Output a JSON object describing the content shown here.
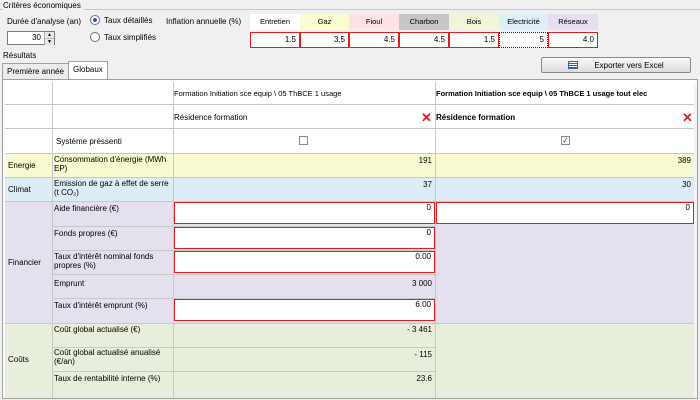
{
  "criteria": {
    "title": "Critères économiques",
    "duration_label": "Durée d'analyse (an)",
    "duration_value": "30",
    "rates": [
      {
        "label": "Taux détaillés",
        "selected": true
      },
      {
        "label": "Taux simplifiés",
        "selected": false
      }
    ],
    "inflation_label": "Inflation annuelle (%)",
    "inflation": [
      {
        "label": "Entretien",
        "value": "1.5",
        "color": "#ffffff"
      },
      {
        "label": "Gaz",
        "value": "3.5",
        "color": "#fbfbd0"
      },
      {
        "label": "Fioul",
        "value": "4.5",
        "color": "#fbe3e0"
      },
      {
        "label": "Charbon",
        "value": "4.5",
        "color": "#c6c6c6"
      },
      {
        "label": "Bois",
        "value": "1.5",
        "color": "#eef5d8"
      },
      {
        "label": "Electricité",
        "value": "5",
        "color": "#ddeffa"
      },
      {
        "label": "Réseaux",
        "value": "4.0",
        "color": "#e6dff2"
      }
    ]
  },
  "results": {
    "title": "Résultats",
    "tabs": [
      {
        "label": "Première année",
        "active": false
      },
      {
        "label": "Globaux",
        "active": true
      }
    ],
    "export_label": "Exporter vers Excel"
  },
  "table": {
    "columns": [
      {
        "title": "Formation Initiation sce equip  \\  05 ThBCE 1 usage",
        "subtitle": "Résidence formation",
        "checked": false,
        "title_bold": false
      },
      {
        "title": "Formation Initiation sce equip  \\  05 ThBCE 1 usage tout elec",
        "subtitle": "Résidence formation",
        "checked": true,
        "title_bold": true
      }
    ],
    "system_label": "Système préssenti",
    "categories": {
      "energie": "Energie",
      "climat": "Climat",
      "financier": "Financier",
      "couts": "Coûts"
    },
    "rows": {
      "consommation": {
        "label": "Consommation d'énergie (MWh EP)",
        "v1": "191",
        "v2": "389"
      },
      "emission": {
        "label": "Emission de gaz à effet de serre (t CO₂)",
        "v1": "37",
        "v2": "30"
      },
      "aide": {
        "label": "Aide financière (€)",
        "v1": "0",
        "v2": "0"
      },
      "fonds": {
        "label": "Fonds propres (€)",
        "v1": "0"
      },
      "taux_nominal": {
        "label": "Taux d'intérêt nominal fonds propres (%)",
        "v1": "0.00"
      },
      "emprunt": {
        "label": "Emprunt",
        "v1": "3 000"
      },
      "taux_emprunt": {
        "label": "Taux d'intérêt emprunt (%)",
        "v1": "6.00"
      },
      "cout_global": {
        "label": "Coût global actualisé (€)",
        "v1": "- 3 461"
      },
      "cout_annualise": {
        "label": "Coût global actualisé anualisé (€/an)",
        "v1": "- 115"
      },
      "tri": {
        "label": "Taux de rentabilité interne (%)",
        "v1": "23.6"
      }
    },
    "colors": {
      "energie": "#fafad2",
      "climat": "#dcedf5",
      "financier": "#e4e0ee",
      "couts": "#e8eedc"
    }
  }
}
